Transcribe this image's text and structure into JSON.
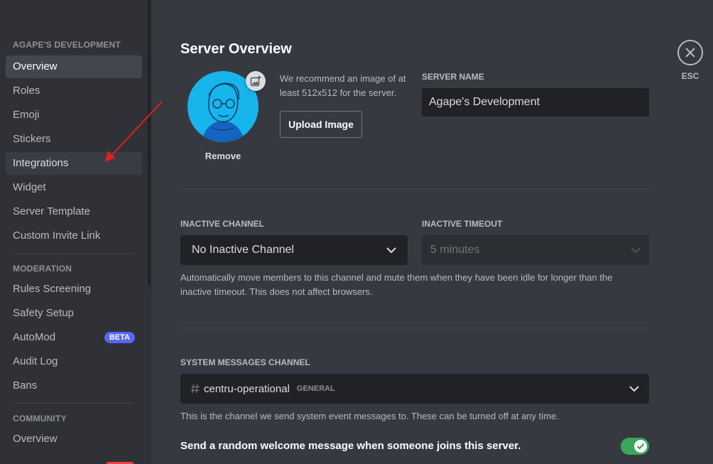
{
  "sidebar": {
    "server_section": "AGAPE'S DEVELOPMENT",
    "items": [
      {
        "label": "Overview"
      },
      {
        "label": "Roles"
      },
      {
        "label": "Emoji"
      },
      {
        "label": "Stickers"
      },
      {
        "label": "Integrations"
      },
      {
        "label": "Widget"
      },
      {
        "label": "Server Template"
      },
      {
        "label": "Custom Invite Link"
      }
    ],
    "moderation_section": "MODERATION",
    "moderation_items": [
      {
        "label": "Rules Screening"
      },
      {
        "label": "Safety Setup"
      },
      {
        "label": "AutoMod",
        "badge": "BETA"
      },
      {
        "label": "Audit Log"
      },
      {
        "label": "Bans"
      }
    ],
    "community_section": "COMMUNITY",
    "community_items": [
      {
        "label": "Overview"
      }
    ]
  },
  "main": {
    "title": "Server Overview",
    "remove_label": "Remove",
    "recommend_text": "We recommend an image of at least 512x512 for the server.",
    "upload_label": "Upload Image",
    "server_name_label": "SERVER NAME",
    "server_name_value": "Agape's Development",
    "inactive_channel_label": "INACTIVE CHANNEL",
    "inactive_channel_value": "No Inactive Channel",
    "inactive_timeout_label": "INACTIVE TIMEOUT",
    "inactive_timeout_value": "5 minutes",
    "inactive_help": "Automatically move members to this channel and mute them when they have been idle for longer than the inactive timeout. This does not affect browsers.",
    "system_channel_label": "SYSTEM MESSAGES CHANNEL",
    "system_channel_name": "centru-operational",
    "system_channel_category": "GENERAL",
    "system_help": "This is the channel we send system event messages to. These can be turned off at any time.",
    "welcome_toggle_label": "Send a random welcome message when someone joins this server.",
    "welcome_toggle_on": true
  },
  "close": {
    "label": "ESC"
  },
  "colors": {
    "accent": "#5865f2",
    "toggle_on": "#3ba55c",
    "avatar_bg": "#18b4ec",
    "annotation_arrow": "#e32020"
  }
}
